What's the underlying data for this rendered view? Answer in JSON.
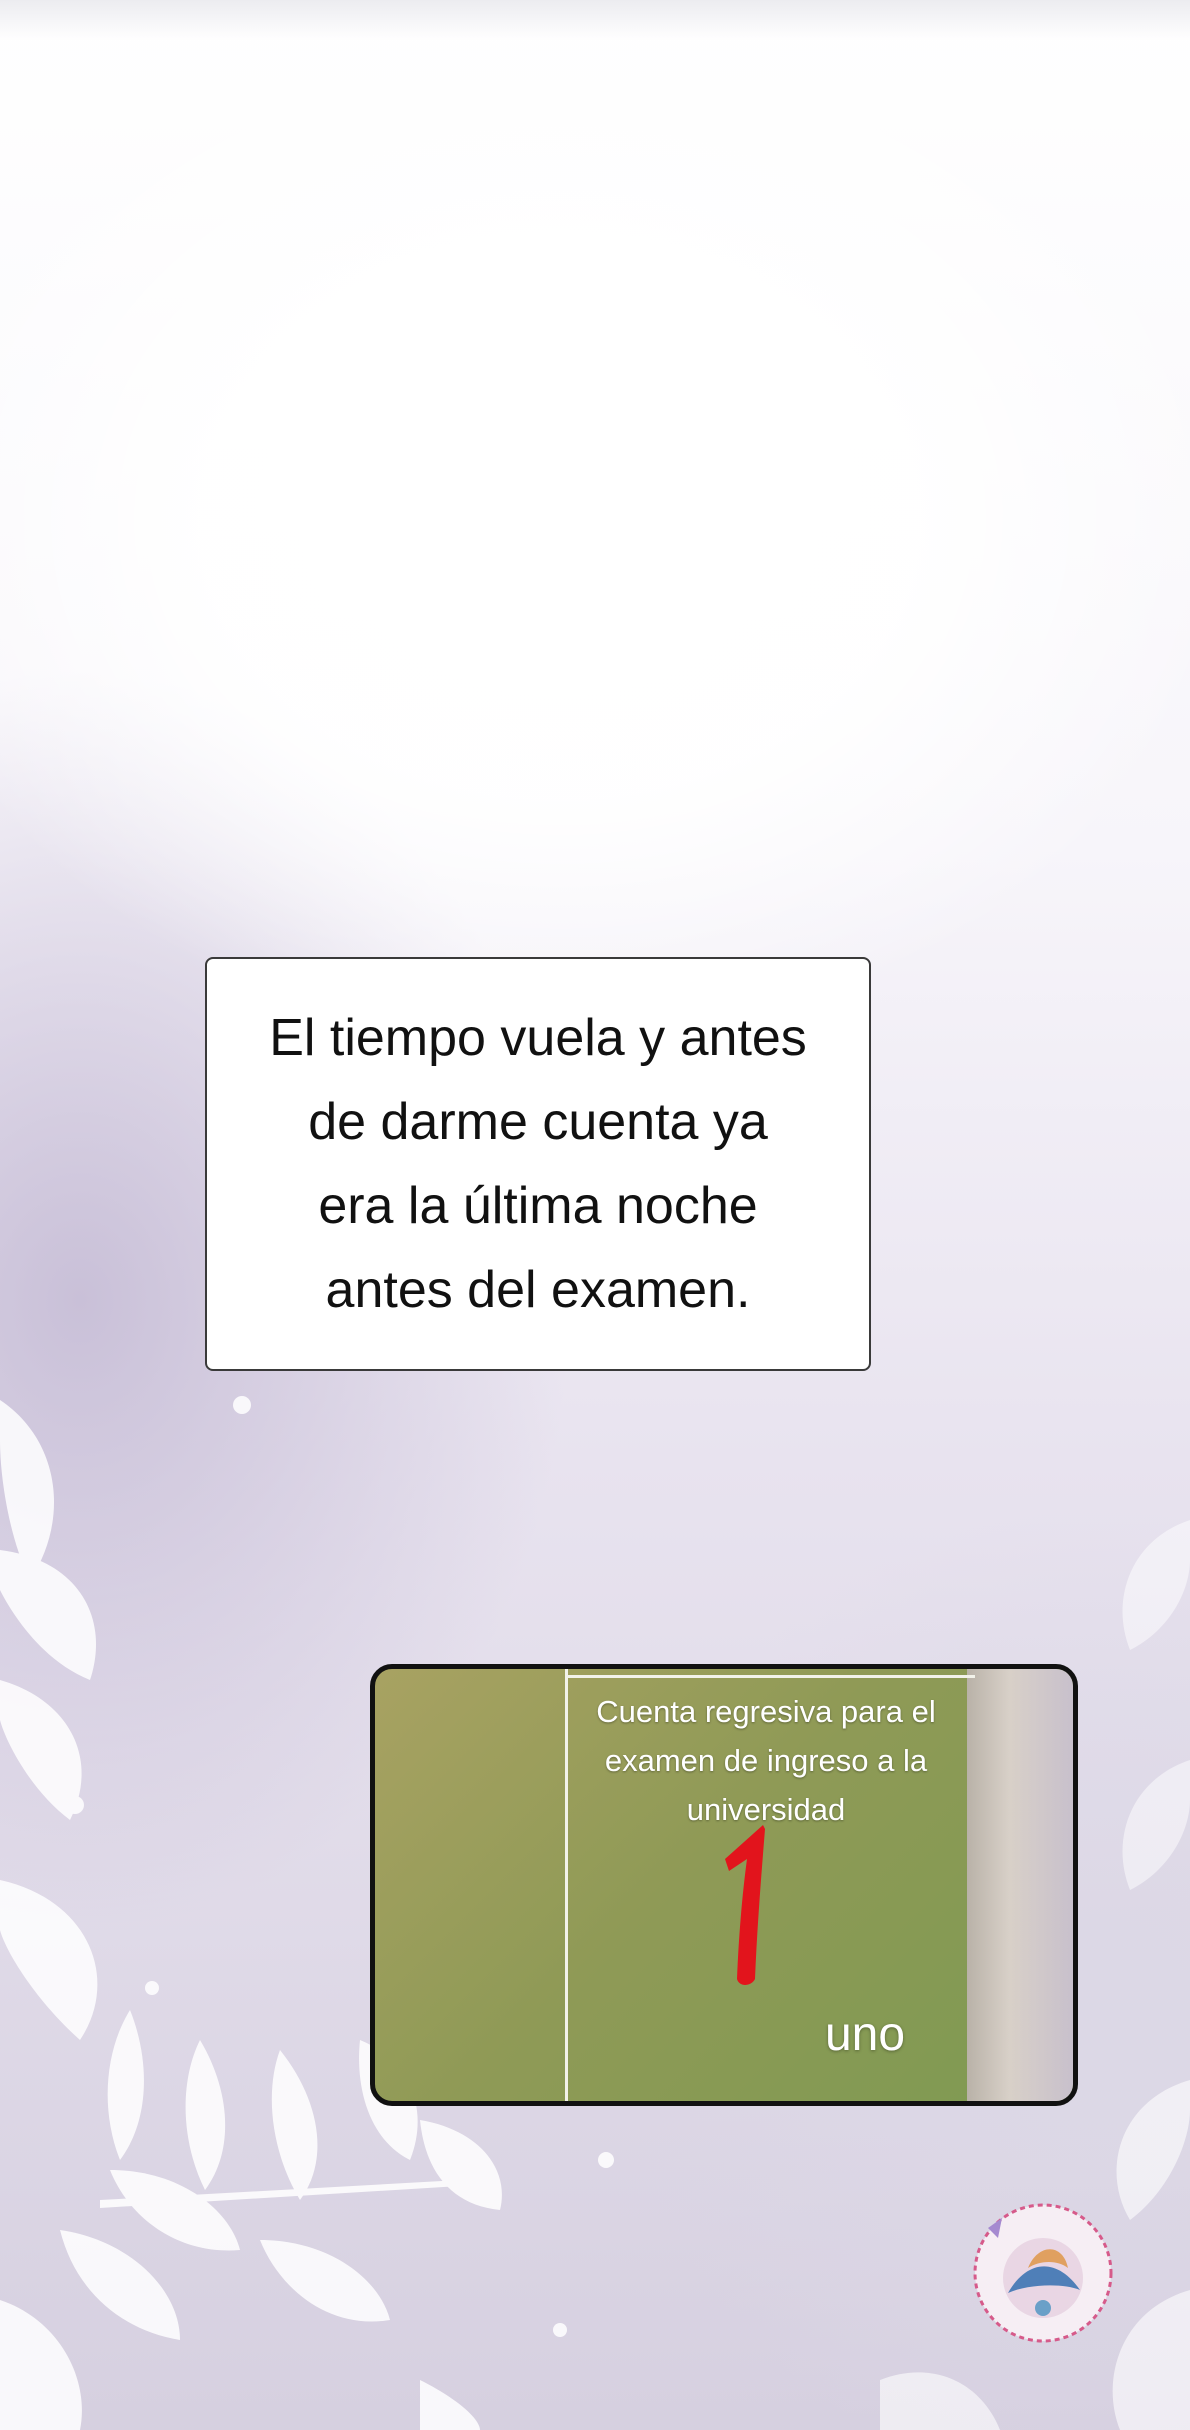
{
  "narration": {
    "text": "El tiempo vuela y antes\nde darme cuenta ya\nera la última noche\nantes del examen."
  },
  "inset": {
    "caption": "Cuenta regresiva para el\nexamen de ingreso a la\nuniversidad",
    "digit": "1",
    "digit_word": "uno"
  },
  "icons": {
    "background_leaves": "leaf-silhouette-icon",
    "watermark": "scanlator-logo-icon"
  },
  "colors": {
    "digit_red": "#e2141c",
    "panel_border": "#111111",
    "background_lavender": "#d6d0e0"
  }
}
